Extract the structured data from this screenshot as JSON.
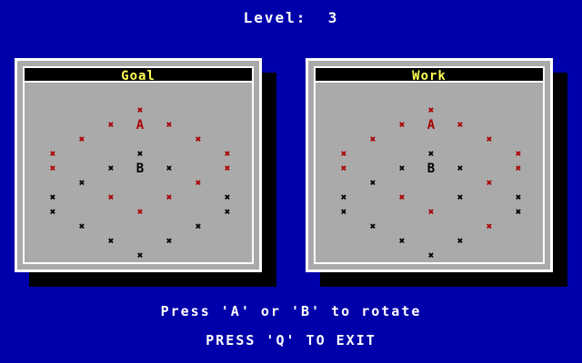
{
  "level": {
    "label": "Level:",
    "value": "3"
  },
  "panels": [
    {
      "title": "Goal",
      "marks": [
        [
          "r",
          0
        ],
        [
          "r",
          1
        ],
        [
          "r",
          2
        ],
        [
          "r",
          3
        ],
        [
          "r",
          4
        ],
        [
          "r",
          5
        ],
        [
          "b",
          6
        ],
        [
          "r",
          7
        ],
        [
          "r",
          8
        ],
        [
          "b",
          9
        ],
        [
          "b",
          10
        ],
        [
          "r",
          11
        ],
        [
          "b",
          12
        ],
        [
          "r",
          13
        ],
        [
          "b",
          14
        ],
        [
          "r",
          15
        ],
        [
          "r",
          16
        ],
        [
          "b",
          17
        ],
        [
          "b",
          18
        ],
        [
          "r",
          19
        ],
        [
          "b",
          20
        ],
        [
          "b",
          21
        ],
        [
          "b",
          22
        ],
        [
          "b",
          23
        ],
        [
          "b",
          24
        ],
        [
          "b",
          25
        ]
      ]
    },
    {
      "title": "Work",
      "marks": [
        [
          "r",
          0
        ],
        [
          "r",
          1
        ],
        [
          "r",
          2
        ],
        [
          "r",
          3
        ],
        [
          "r",
          4
        ],
        [
          "r",
          5
        ],
        [
          "b",
          6
        ],
        [
          "r",
          7
        ],
        [
          "r",
          8
        ],
        [
          "b",
          9
        ],
        [
          "b",
          10
        ],
        [
          "r",
          11
        ],
        [
          "b",
          12
        ],
        [
          "r",
          13
        ],
        [
          "b",
          14
        ],
        [
          "r",
          15
        ],
        [
          "b",
          16
        ],
        [
          "b",
          17
        ],
        [
          "b",
          18
        ],
        [
          "r",
          19
        ],
        [
          "b",
          20
        ],
        [
          "b",
          21
        ],
        [
          "r",
          22
        ],
        [
          "b",
          23
        ],
        [
          "b",
          24
        ],
        [
          "b",
          25
        ]
      ]
    }
  ],
  "rotor_labels": {
    "a": "A",
    "b": "B"
  },
  "colors": {
    "background": "#0000aa",
    "red": "#aa0000",
    "title": "#ffff55"
  },
  "hint_rotate": "Press 'A' or 'B' to rotate",
  "hint_exit": "PRESS 'Q' TO EXIT"
}
